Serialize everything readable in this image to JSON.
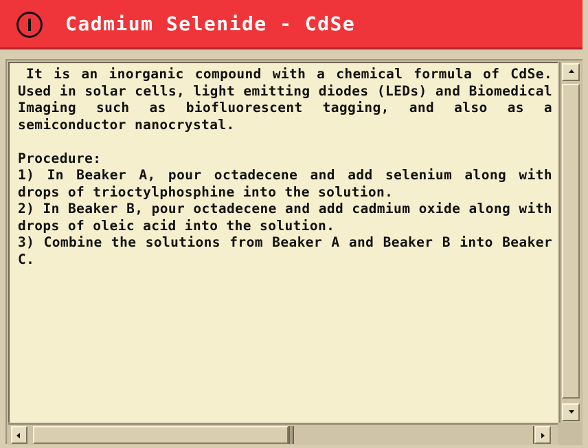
{
  "window": {
    "title": "Cadmium Selenide - CdSe",
    "title_icon": "info-icon",
    "title_bar_color": "#f0353a",
    "background_color": "#f5efcd"
  },
  "content": {
    "paragraphs": [
      "It is an inorganic compound with a chemical formula of CdSe. Used in solar cells, light emitting diodes (LEDs) and Biomedical Imaging such as biofluorescent tagging, and also as a semiconductor nanocrystal.",
      "Procedure:",
      "1) In Beaker A, pour octadecene and add selenium along with drops of trioctylphosphine into the solution.",
      "2) In Beaker B, pour octadecene and add cadmium oxide along with drops of oleic acid into the solution.",
      "3) Combine the solutions from Beaker A and Beaker B into Beaker C."
    ]
  },
  "scrollbars": {
    "vertical": {
      "up_icon": "arrow-up-icon",
      "down_icon": "arrow-down-icon"
    },
    "horizontal": {
      "left_icon": "arrow-left-icon",
      "right_icon": "arrow-right-icon"
    }
  }
}
